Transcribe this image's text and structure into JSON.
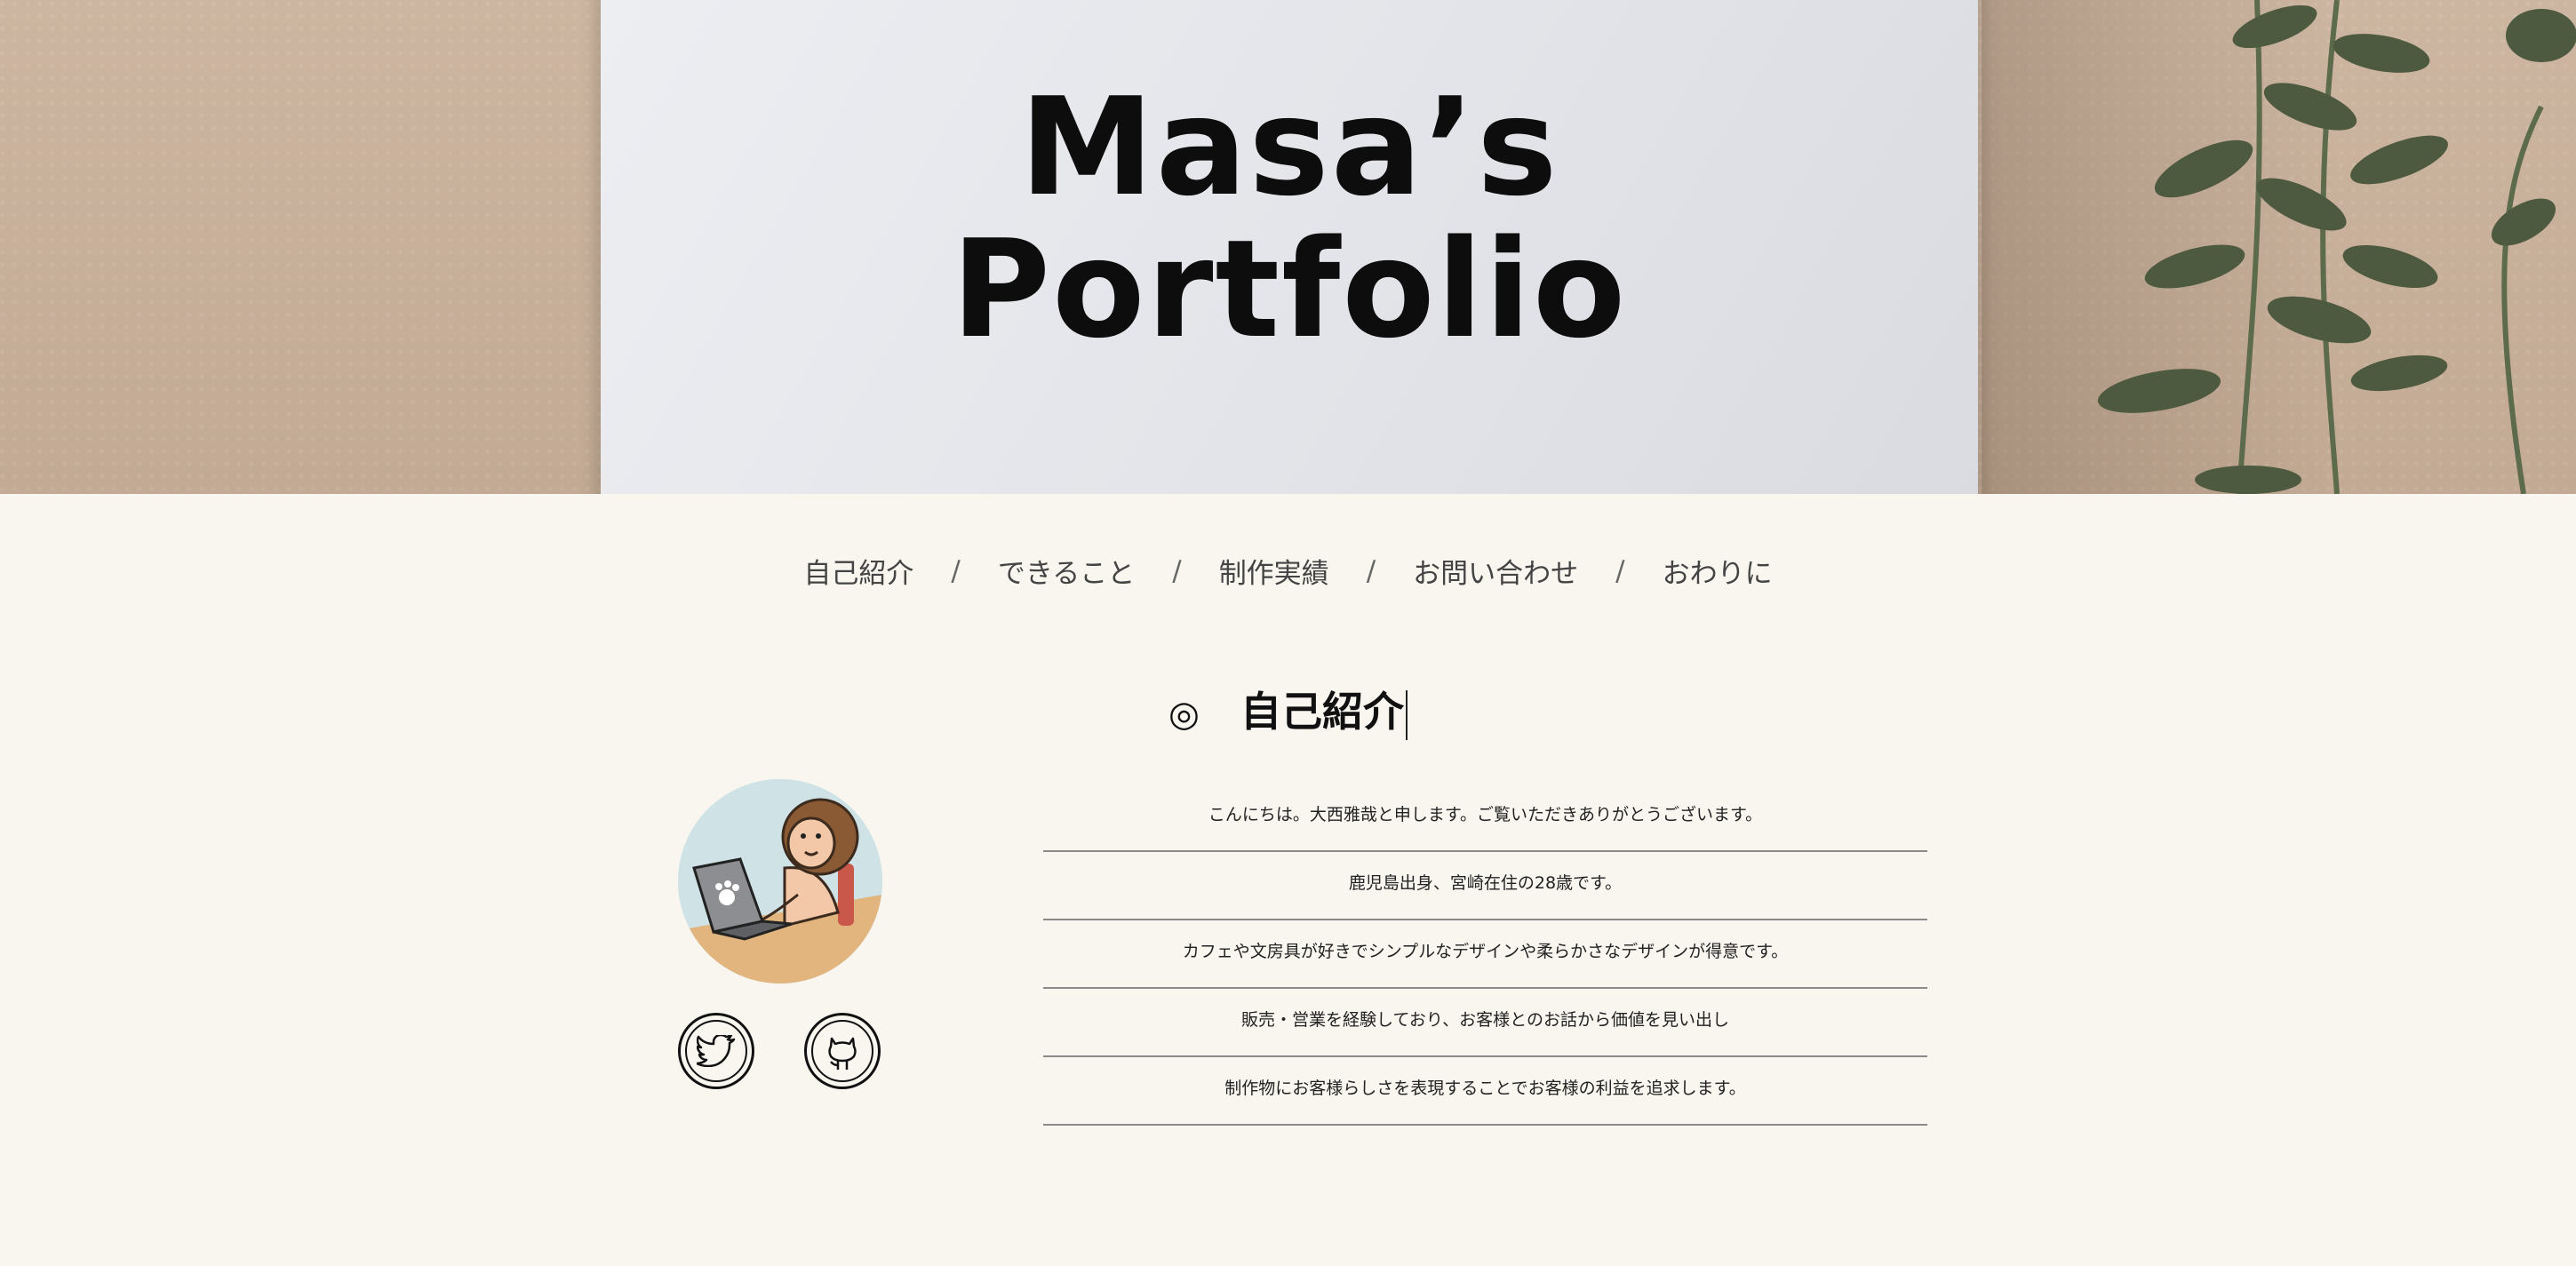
{
  "hero": {
    "title_line1": "Masa’s",
    "title_line2": "Portfolio"
  },
  "nav": {
    "items": [
      "自己紹介",
      "できること",
      "制作実績",
      "お問い合わせ",
      "おわりに"
    ],
    "separator": "/"
  },
  "section": {
    "mark": "◎",
    "title": "自己紹介"
  },
  "profile": {
    "avatar_icon": "lion-with-laptop-illustration",
    "social_icons": [
      "twitter-icon",
      "github-icon"
    ]
  },
  "intro": {
    "lines": [
      "こんにちは。大西雅哉と申します。ご覧いただきありがとうございます。",
      "鹿児島出身、宮崎在住の28歳です。",
      "カフェや文房具が好きでシンプルなデザインや柔らかさなデザインが得意です。",
      "販売・営業を経験しており、お客様とのお話から価値を見い出し",
      "制作物にお客様らしさを表現することでお客様の利益を追求します。"
    ]
  },
  "colors": {
    "background": "#f9f6f0",
    "hero_kraft": "#c8b19c",
    "paper": "#e6e8ec",
    "divider": "#8a8a8a"
  }
}
